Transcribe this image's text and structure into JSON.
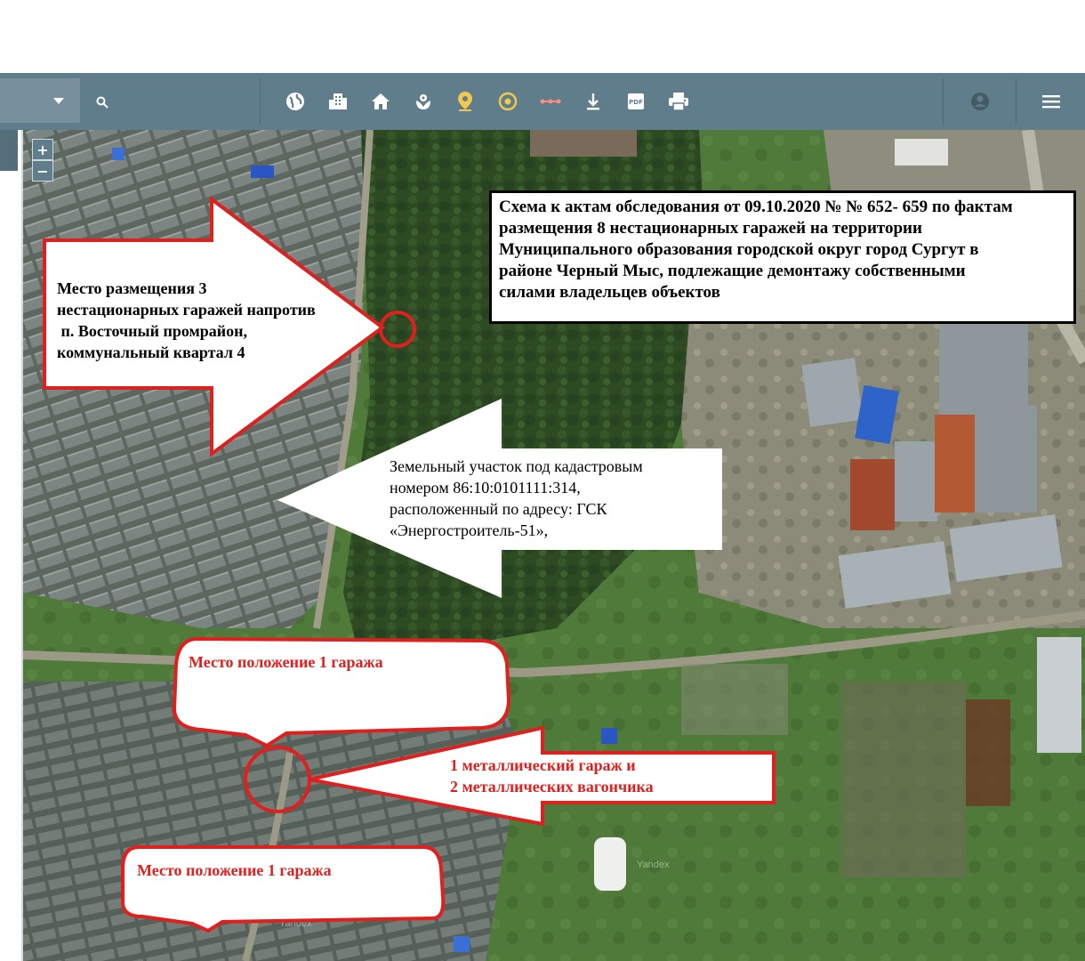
{
  "toolbar": {
    "tools": [
      {
        "name": "globe-icon"
      },
      {
        "name": "buildings-icon"
      },
      {
        "name": "home-icon"
      },
      {
        "name": "plant-icon"
      },
      {
        "name": "map-pin-icon"
      },
      {
        "name": "target-icon"
      },
      {
        "name": "measure-icon"
      },
      {
        "name": "download-icon"
      },
      {
        "name": "pdf-icon"
      },
      {
        "name": "print-icon"
      }
    ],
    "account_icon": "account-icon",
    "menu_icon": "menu-icon",
    "search_icon": "search-icon"
  },
  "map": {
    "zoom_in": "+",
    "zoom_out": "−",
    "watermarks": [
      "Yandex",
      "Yandex"
    ]
  },
  "annotations": {
    "title": "Схема к актам обследования от 09.10.2020 № № 652- 659 по фактам размещения 8 нестационарных гаражей на территории Муниципального образования городской округ город Сургут в районе Черный Мыс, подлежащие демонтажу собственными силами владельцев объектов",
    "title_lines": [
      "Схема к актам обследования от 09.10.2020 № № 652- 659 по фактам",
      "размещения 8 нестационарных гаражей на территории",
      "Муниципального образования городской округ город Сургут в",
      "районе Черный Мыс, подлежащие демонтажу собственными",
      "силами владельцев объектов"
    ],
    "placement_3": [
      "Место размещения 3",
      "нестационарных гаражей напротив",
      " п. Восточный промрайон,",
      "коммунальный квартал  4"
    ],
    "cadastral": [
      "Земельный участок под кадастровым",
      "номером 86:10:0101111:314,",
      "расположенный по адресу: ГСК",
      "«Энергостроитель-51»,"
    ],
    "garage_1_top": "Место положение 1 гаража",
    "garage_1_bottom": "Место положение 1 гаража",
    "metal": [
      "1 металлический гараж и",
      "2 металлических вагончика"
    ]
  },
  "colors": {
    "toolbar": "#607d8b",
    "annotation_red": "#e0201e",
    "text_red": "#e0201e",
    "map_green": "#3f5a2e"
  }
}
